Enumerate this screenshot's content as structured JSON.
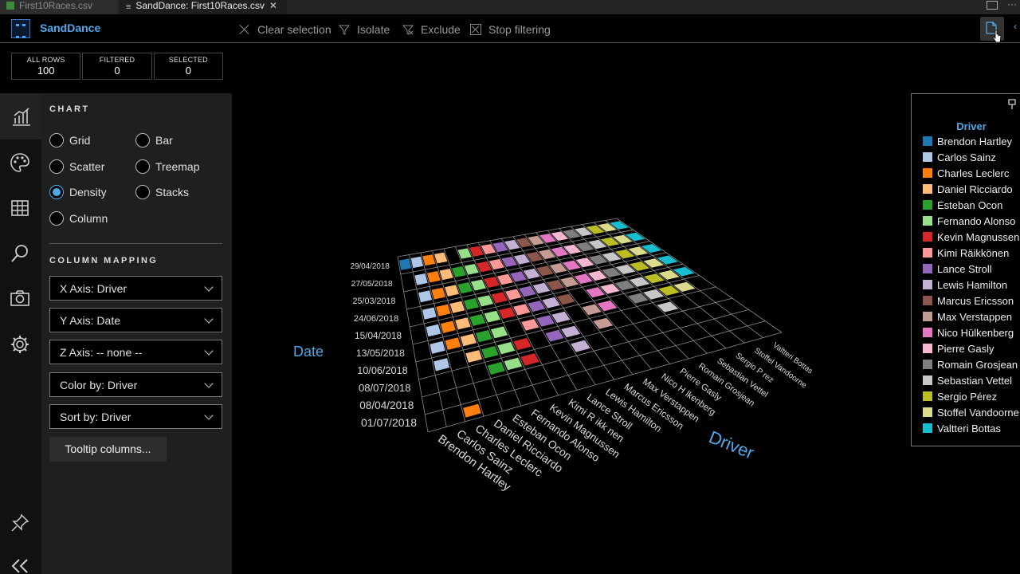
{
  "tabs": [
    {
      "label": "First10Races.csv",
      "active": false
    },
    {
      "label": "SandDance: First10Races.csv",
      "active": true
    }
  ],
  "toolbar": {
    "app_title": "SandDance",
    "clear_selection": "Clear selection",
    "isolate": "Isolate",
    "exclude": "Exclude",
    "stop_filtering": "Stop filtering"
  },
  "counts": {
    "all_rows_label": "ALL ROWS",
    "all_rows": "100",
    "filtered_label": "FILTERED",
    "filtered": "0",
    "selected_label": "SELECTED",
    "selected": "0"
  },
  "chart_panel": {
    "title": "CHART",
    "types": [
      "Grid",
      "Bar",
      "Scatter",
      "Treemap",
      "Density",
      "Stacks",
      "Column"
    ],
    "selected": "Density",
    "column_mapping_title": "COLUMN MAPPING",
    "x_axis": "X Axis: Driver",
    "y_axis": "Y Axis: Date",
    "z_axis": "Z Axis: -- none --",
    "color_by": "Color by: Driver",
    "sort_by": "Sort by: Driver",
    "tooltip_button": "Tooltip columns..."
  },
  "legend": {
    "title": "Driver",
    "items": [
      {
        "label": "Brendon Hartley",
        "color": "#1f77b4"
      },
      {
        "label": "Carlos Sainz",
        "color": "#aec7e8"
      },
      {
        "label": "Charles Leclerc",
        "color": "#ff7f0e"
      },
      {
        "label": "Daniel Ricciardo",
        "color": "#ffbb78"
      },
      {
        "label": "Esteban Ocon",
        "color": "#2ca02c"
      },
      {
        "label": "Fernando Alonso",
        "color": "#98df8a"
      },
      {
        "label": "Kevin Magnussen",
        "color": "#d62728"
      },
      {
        "label": "Kimi Räikkönen",
        "color": "#ff9896"
      },
      {
        "label": "Lance Stroll",
        "color": "#9467bd"
      },
      {
        "label": "Lewis Hamilton",
        "color": "#c5b0d5"
      },
      {
        "label": "Marcus Ericsson",
        "color": "#8c564b"
      },
      {
        "label": "Max Verstappen",
        "color": "#c49c94"
      },
      {
        "label": "Nico Hülkenberg",
        "color": "#e377c2"
      },
      {
        "label": "Pierre Gasly",
        "color": "#f7b6d2"
      },
      {
        "label": "Romain Grosjean",
        "color": "#7f7f7f"
      },
      {
        "label": "Sebastian Vettel",
        "color": "#c7c7c7"
      },
      {
        "label": "Sergio Pérez",
        "color": "#bcbd22"
      },
      {
        "label": "Stoffel Vandoorne",
        "color": "#dbdb8d"
      },
      {
        "label": "Valtteri Bottas",
        "color": "#17becf"
      }
    ]
  },
  "chart_data": {
    "type": "heatmap",
    "xlabel": "Driver",
    "ylabel": "Date",
    "x_tick_labels": [
      "Brendon Hartley",
      "Carlos Sainz",
      "Charles Leclerc",
      "Daniel Ricciardo",
      "Esteban Ocon",
      "Fernando Alonso",
      "Kevin Magnussen",
      "Kimi R ikk nen",
      "Lance Stroll",
      "Lewis Hamilton",
      "Marcus Ericsson",
      "Max Verstappen",
      "Nico H lkenberg",
      "Pierre Gasly",
      "Romain Grosjean",
      "Sebastian Vettel",
      "Sergio P rez",
      "Stoffel Vandoorne",
      "Valtteri Bottas"
    ],
    "y_tick_labels": [
      "01/07/2018",
      "08/04/2018",
      "08/07/2018",
      "10/06/2018",
      "13/05/2018",
      "15/04/2018",
      "24/06/2018",
      "25/03/2018",
      "27/05/2018",
      "29/04/2018"
    ],
    "cells": [
      [
        9,
        0
      ],
      [
        9,
        1
      ],
      [
        9,
        2
      ],
      [
        8,
        1
      ],
      [
        7,
        1
      ],
      [
        6,
        1
      ],
      [
        5,
        1
      ],
      [
        4,
        1
      ],
      [
        3,
        1
      ],
      [
        8,
        2
      ],
      [
        7,
        2
      ],
      [
        6,
        2
      ],
      [
        5,
        2
      ],
      [
        4,
        2
      ],
      [
        9,
        3
      ],
      [
        8,
        3
      ],
      [
        7,
        3
      ],
      [
        6,
        3
      ],
      [
        5,
        3
      ],
      [
        4,
        3
      ],
      [
        3,
        3
      ],
      [
        8,
        4
      ],
      [
        7,
        4
      ],
      [
        6,
        4
      ],
      [
        5,
        4
      ],
      [
        4,
        4
      ],
      [
        3,
        4
      ],
      [
        2,
        4
      ],
      [
        0,
        2
      ],
      [
        9,
        5
      ],
      [
        8,
        5
      ],
      [
        7,
        5
      ],
      [
        6,
        5
      ],
      [
        5,
        5
      ],
      [
        4,
        5
      ],
      [
        3,
        5
      ],
      [
        2,
        5
      ],
      [
        9,
        6
      ],
      [
        8,
        6
      ],
      [
        7,
        6
      ],
      [
        6,
        6
      ],
      [
        5,
        6
      ],
      [
        3,
        6
      ],
      [
        2,
        6
      ],
      [
        9,
        7
      ],
      [
        8,
        7
      ],
      [
        7,
        7
      ],
      [
        6,
        7
      ],
      [
        5,
        7
      ],
      [
        4,
        7
      ],
      [
        9,
        8
      ],
      [
        8,
        8
      ],
      [
        7,
        8
      ],
      [
        6,
        8
      ],
      [
        5,
        8
      ],
      [
        4,
        8
      ],
      [
        3,
        8
      ],
      [
        9,
        9
      ],
      [
        8,
        9
      ],
      [
        7,
        9
      ],
      [
        6,
        9
      ],
      [
        5,
        9
      ],
      [
        4,
        9
      ],
      [
        3,
        9
      ],
      [
        2,
        9
      ],
      [
        9,
        10
      ],
      [
        8,
        10
      ],
      [
        7,
        10
      ],
      [
        6,
        10
      ],
      [
        5,
        10
      ],
      [
        9,
        11
      ],
      [
        8,
        11
      ],
      [
        7,
        11
      ],
      [
        6,
        11
      ],
      [
        4,
        11
      ],
      [
        3,
        11
      ],
      [
        9,
        12
      ],
      [
        8,
        12
      ],
      [
        7,
        12
      ],
      [
        6,
        12
      ],
      [
        5,
        12
      ],
      [
        4,
        12
      ],
      [
        9,
        13
      ],
      [
        8,
        13
      ],
      [
        7,
        13
      ],
      [
        6,
        13
      ],
      [
        5,
        13
      ],
      [
        9,
        14
      ],
      [
        8,
        14
      ],
      [
        7,
        14
      ],
      [
        6,
        14
      ],
      [
        5,
        14
      ],
      [
        4,
        14
      ],
      [
        9,
        15
      ],
      [
        8,
        15
      ],
      [
        7,
        15
      ],
      [
        6,
        15
      ],
      [
        5,
        15
      ],
      [
        4,
        15
      ],
      [
        3,
        15
      ],
      [
        9,
        16
      ],
      [
        8,
        16
      ],
      [
        7,
        16
      ],
      [
        6,
        16
      ],
      [
        5,
        16
      ],
      [
        4,
        16
      ],
      [
        9,
        17
      ],
      [
        8,
        17
      ],
      [
        7,
        17
      ],
      [
        6,
        17
      ],
      [
        5,
        17
      ],
      [
        4,
        17
      ],
      [
        9,
        18
      ],
      [
        8,
        18
      ],
      [
        7,
        18
      ],
      [
        6,
        18
      ],
      [
        5,
        18
      ]
    ]
  }
}
